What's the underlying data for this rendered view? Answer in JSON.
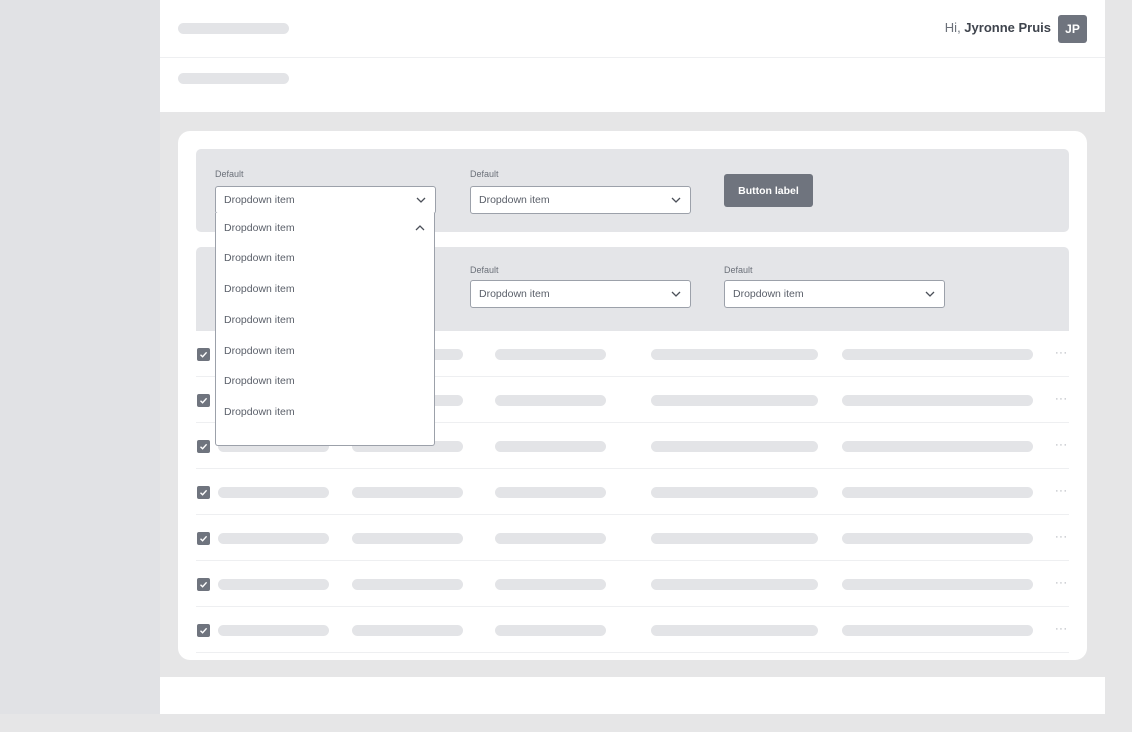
{
  "header": {
    "greeting_prefix": "Hi, ",
    "user_name": "Jyronne Pruis",
    "avatar_initials": "JP"
  },
  "filters": {
    "row1": [
      {
        "label": "Default",
        "value": "Dropdown item"
      },
      {
        "label": "Default",
        "value": "Dropdown item"
      }
    ],
    "button_label": "Button label",
    "row2": [
      {
        "label": "Default",
        "value": "Dropdown item"
      },
      {
        "label": "Default",
        "value": "Dropdown item"
      }
    ]
  },
  "open_menu": {
    "selected": "Dropdown item",
    "items": [
      "Dropdown item",
      "Dropdown item",
      "Dropdown item",
      "Dropdown item",
      "Dropdown item",
      "Dropdown item"
    ]
  },
  "table": {
    "row_count": 7,
    "more_label": "···"
  },
  "icons": [
    "chevron-down-icon",
    "chevron-up-icon",
    "check-icon",
    "more-dots-icon"
  ],
  "colors": {
    "accent": "#6f747e",
    "panel": "#e4e5e8",
    "skeleton": "#e3e4e7",
    "background": "#e6e6e7"
  }
}
